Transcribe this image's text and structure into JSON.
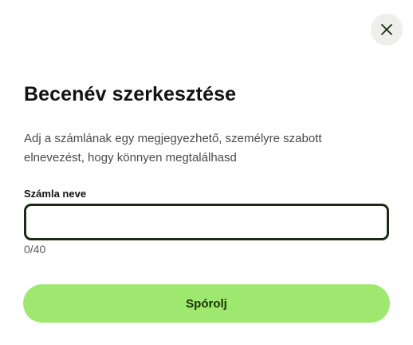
{
  "dialog": {
    "close_icon": "close-icon",
    "title": "Becenév szerkesztése",
    "description": "Adj a számlának egy megjegyezhető, személyre szabott elnevezést, hogy könnyen megtalálhasd",
    "field": {
      "label": "Számla neve",
      "value": "",
      "placeholder": "",
      "counter": "0/40"
    },
    "save_label": "Spórolj"
  },
  "colors": {
    "accent": "#9fe870",
    "accent_text": "#163300",
    "input_border": "#1a2a14",
    "close_bg": "#eeefea"
  }
}
